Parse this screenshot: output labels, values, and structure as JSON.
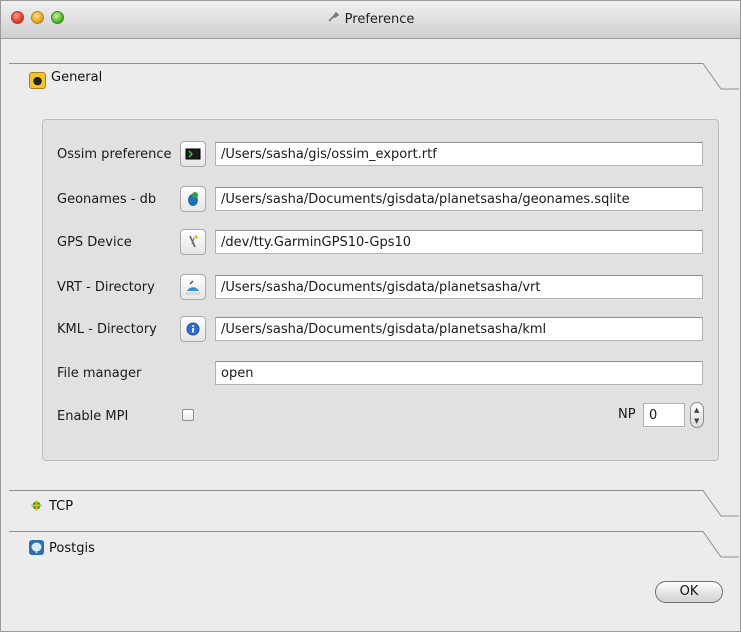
{
  "window": {
    "title": "Preference"
  },
  "sections": {
    "general": {
      "label": "General"
    },
    "tcp": {
      "label": "TCP"
    },
    "postgis": {
      "label": "Postgis"
    }
  },
  "general_form": {
    "ossim_preference": {
      "label": "Ossim preference",
      "value": "/Users/sasha/gis/ossim_export.rtf",
      "icon": "terminal-icon"
    },
    "geonames_db": {
      "label": "Geonames - db",
      "value": "/Users/sasha/Documents/gisdata/planetsasha/geonames.sqlite",
      "icon": "database-icon"
    },
    "gps_device": {
      "label": "GPS Device",
      "value": "/dev/tty.GarminGPS10-Gps10",
      "icon": "satellite-icon"
    },
    "vrt_directory": {
      "label": "VRT - Directory",
      "value": "/Users/sasha/Documents/gisdata/planetsasha/vrt",
      "icon": "gdal-icon"
    },
    "kml_directory": {
      "label": "KML - Directory",
      "value": "/Users/sasha/Documents/gisdata/planetsasha/kml",
      "icon": "info-icon"
    },
    "file_manager": {
      "label": "File manager",
      "value": "open"
    },
    "enable_mpi": {
      "label": "Enable MPI",
      "checked": false
    },
    "np": {
      "label": "NP",
      "value": "0"
    }
  },
  "buttons": {
    "ok": "OK"
  }
}
